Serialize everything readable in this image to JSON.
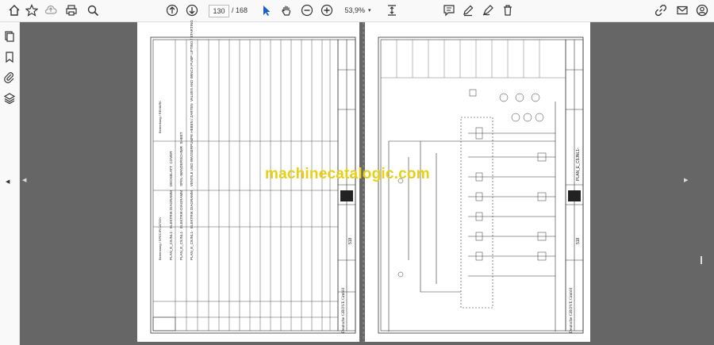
{
  "toolbar": {
    "page_current": "130",
    "page_total": "/ 168",
    "zoom": "53,9%",
    "icons": [
      "home-icon",
      "star-icon",
      "upload-icon",
      "print-icon",
      "zoom-search-icon",
      "prev-page-icon",
      "next-page-icon",
      "select-cursor-icon",
      "hand-tool-icon",
      "zoom-out-icon",
      "zoom-in-icon",
      "page-fit-icon",
      "comment-icon",
      "pen-icon",
      "draw-icon",
      "delete-icon",
      "link-icon",
      "mail-icon",
      "account-icon"
    ]
  },
  "sidebar": {
    "icons": [
      "pages-icon",
      "bookmark-icon",
      "attachment-icon",
      "layers-icon"
    ]
  },
  "left_page": {
    "company": "Deutsche GROVE GmbH",
    "doc_rows": [
      {
        "no": "1",
        "plan": "PLAN_E_C9JNL1-",
        "spec": "ELEKTRIK DIAGRAMM",
        "desc": "DECKBLATT",
        "note": "COVER"
      },
      {
        "no": "2",
        "plan": "PLAN_E_C9JNL1-",
        "spec": "ELEKTRIK-DIAGRAMM",
        "desc": "SPIN.-WANDERSCHIMR",
        "note": "SHEET"
      },
      {
        "no": "3",
        "plan": "PLAN_E_C9JNL1-",
        "spec": "ELEKTRIK DIAGRAMM",
        "desc": "VENTILE UND WASSERPUMPE HEBEN / ZARTEN",
        "note": "VALVES AND WINCH PUMP LIFTING / STARTING"
      }
    ],
    "header_specification": "Benennung / SPECIFICATION",
    "header_note": "Bemerkung / REMARK",
    "sheet": "518"
  },
  "right_page": {
    "company": "Deutsche GROVE GmbH",
    "plan": "PLAN_E_C9JNL1-",
    "sheet": "518"
  },
  "watermark": "machinecatalogic.com"
}
